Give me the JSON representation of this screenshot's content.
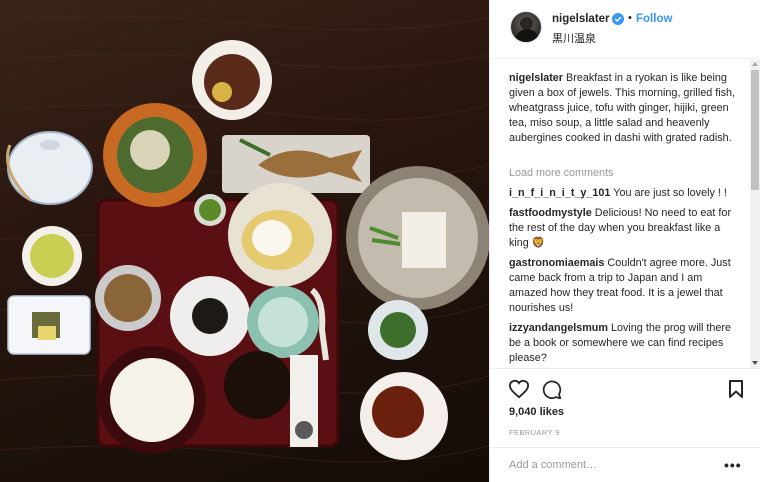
{
  "header": {
    "username": "nigelslater",
    "separator": "•",
    "follow_label": "Follow",
    "location": "黒川温泉"
  },
  "caption": {
    "username": "nigelslater",
    "text": "Breakfast in a ryokan is like being given a box of jewels. This morning, grilled fish, wheatgrass juice, tofu with ginger, hijiki, green tea, miso soup, a little salad and heavenly aubergines cooked in dashi with grated radish."
  },
  "load_more_label": "Load more comments",
  "comments": [
    {
      "username": "i_n_f_i_n_i_t_y_101",
      "text": "You are just so lovely ! !"
    },
    {
      "username": "fastfoodmystyle",
      "text": "Delicious! No need to eat for the rest of the day when you breakfast like a king 🦁"
    },
    {
      "username": "gastronomiaemais",
      "text": "Couldn't agree more. Just came back from a trip to Japan and I am amazed how they treat food. It is a jewel that nourishes us!"
    },
    {
      "username": "izzyandangelsmum",
      "text": "Loving the prog will there be a book or somewhere we can find recipes please?"
    }
  ],
  "likes": "9,040 likes",
  "date": "FEBRUARY 9",
  "add_comment": {
    "placeholder": "Add a comment…"
  },
  "more_options": "•••",
  "icons": {
    "like": "heart-icon",
    "comment": "speech-bubble-icon",
    "save": "bookmark-icon",
    "verified": "verified-badge-icon"
  },
  "colors": {
    "follow": "#3897f0",
    "verified": "#3897f0",
    "muted": "#999999",
    "text": "#262626"
  }
}
